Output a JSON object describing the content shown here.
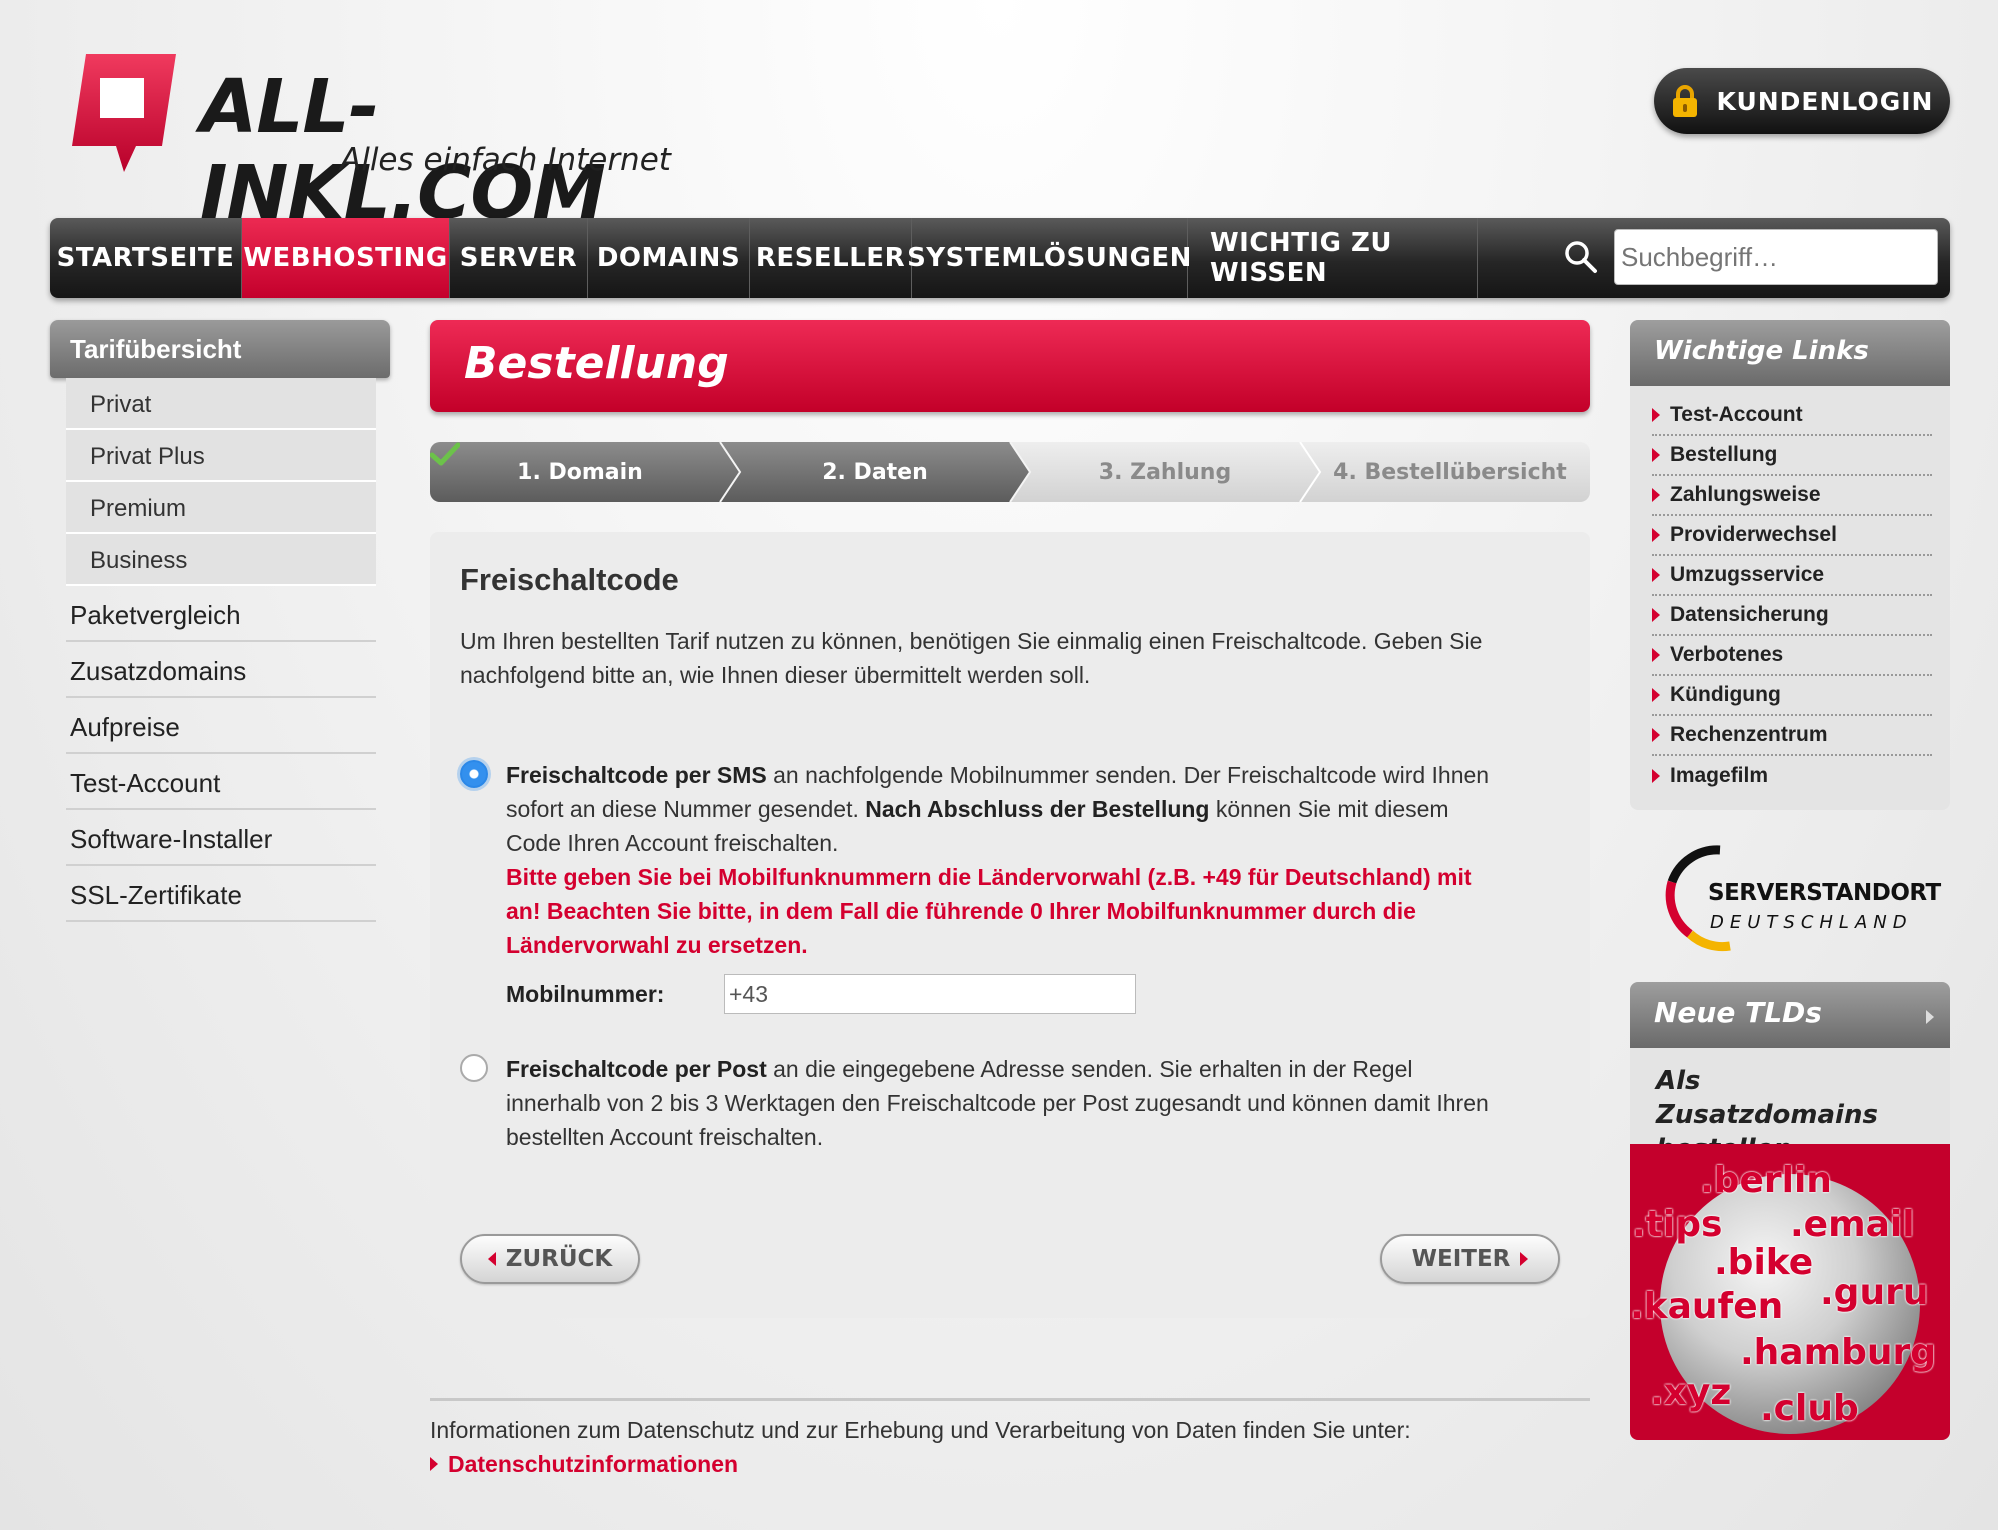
{
  "header": {
    "logo_text": "ALL-INKL.COM",
    "tagline": "Alles einfach Internet",
    "login_label": "KUNDENLOGIN"
  },
  "nav": {
    "items": [
      {
        "label": "STARTSEITE",
        "active": false
      },
      {
        "label": "WEBHOSTING",
        "active": true
      },
      {
        "label": "SERVER",
        "active": false
      },
      {
        "label": "DOMAINS",
        "active": false
      },
      {
        "label": "RESELLER",
        "active": false
      },
      {
        "label": "SYSTEMLÖSUNGEN",
        "active": false
      },
      {
        "label": "WICHTIG ZU WISSEN",
        "active": false
      }
    ],
    "search_placeholder": "Suchbegriff…",
    "search_icon": "search-icon"
  },
  "sidebar_left": {
    "heading": "Tarifübersicht",
    "sub_items": [
      "Privat",
      "Privat Plus",
      "Premium",
      "Business"
    ],
    "items": [
      "Paketvergleich",
      "Zusatzdomains",
      "Aufpreise",
      "Test-Account",
      "Software-Installer",
      "SSL-Zertifikate"
    ]
  },
  "main": {
    "banner_title": "Bestellung",
    "steps": [
      {
        "label": "1. Domain",
        "state": "done"
      },
      {
        "label": "2. Daten",
        "state": "current"
      },
      {
        "label": "3. Zahlung",
        "state": "upcoming"
      },
      {
        "label": "4. Bestellübersicht",
        "state": "upcoming"
      }
    ],
    "panel_title": "Freischaltcode",
    "intro": "Um Ihren bestellten Tarif nutzen zu können, benötigen Sie einmalig einen Freischaltcode. Geben Sie nachfolgend bitte an, wie Ihnen dieser übermittelt werden soll.",
    "option_sms": {
      "selected": true,
      "bold1": "Freischaltcode per SMS",
      "text1": " an nachfolgende Mobilnummer senden. Der Freischaltcode wird Ihnen sofort an diese Nummer gesendet. ",
      "bold2": "Nach Abschluss der Bestellung",
      "text2": " können Sie mit diesem Code Ihren Account freischalten.",
      "warning": "Bitte geben Sie bei Mobilfunknummern die Ländervorwahl (z.B. +49 für Deutschland) mit an! Beachten Sie bitte, in dem Fall die führende 0 Ihrer Mobilfunknummer durch die Ländervorwahl zu ersetzen.",
      "field_label": "Mobilnummer:",
      "field_value": "+43"
    },
    "option_post": {
      "selected": false,
      "bold1": "Freischaltcode per Post",
      "text1": " an die eingegebene Adresse senden. Sie erhalten in der Regel innerhalb von 2 bis 3 Werktagen den Freischaltcode per Post zugesandt und können damit Ihren bestellten Account freischalten."
    },
    "back_label": "ZURÜCK",
    "next_label": "WEITER"
  },
  "footer": {
    "note": "Informationen zum Datenschutz und zur Erhebung und Verarbeitung von Daten finden Sie unter:",
    "link": "Datenschutzinformationen"
  },
  "sidebar_right": {
    "links_heading": "Wichtige Links",
    "links": [
      "Test-Account",
      "Bestellung",
      "Zahlungsweise",
      "Providerwechsel",
      "Umzugsservice",
      "Datensicherung",
      "Verbotenes",
      "Kündigung",
      "Rechenzentrum",
      "Imagefilm"
    ],
    "seal_line1": "SERVERSTANDORT",
    "seal_line2": "DEUTSCHLAND",
    "tld_heading": "Neue TLDs",
    "tld_subheading": "Als Zusatzdomains bestellen",
    "tld_words": [
      ".berlin",
      ".tips",
      ".email",
      ".bike",
      ".kaufen",
      ".guru",
      ".hamburg",
      ".xyz",
      ".club"
    ]
  },
  "colors": {
    "brand_red": "#d4002f",
    "nav_dark": "#1f1f1f",
    "radio_blue": "#3390ee",
    "check_green": "#6cc24a"
  }
}
